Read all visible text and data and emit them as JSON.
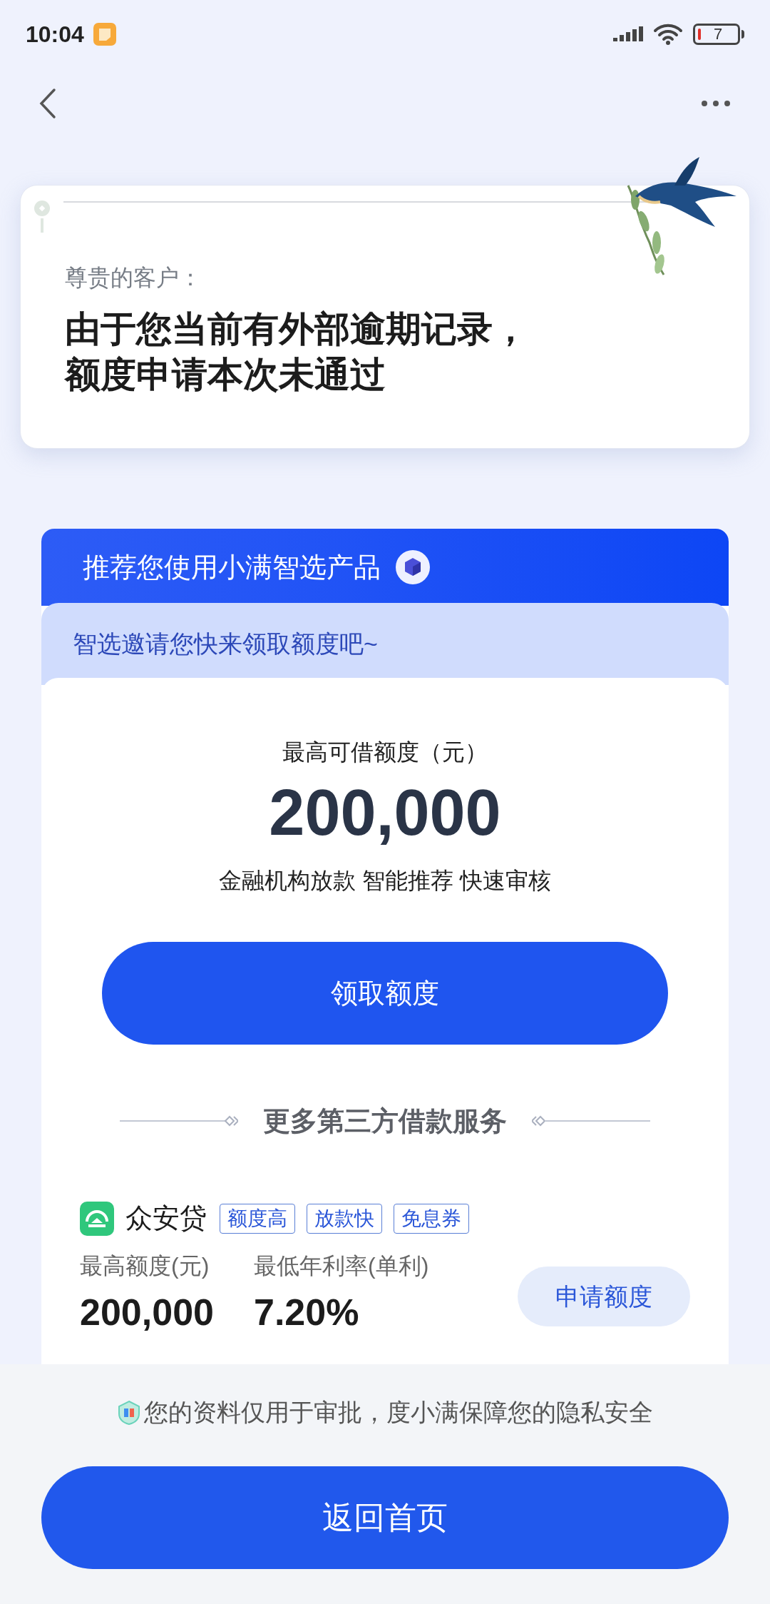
{
  "status_bar": {
    "time": "10:04",
    "battery": "7"
  },
  "notice": {
    "greeting": "尊贵的客户：",
    "message_lines": [
      "由于您当前有外部逾期记录，",
      "额度申请本次未通过"
    ]
  },
  "recommend": {
    "title": "推荐您使用小满智选产品",
    "subtitle": "智选邀请您快来领取额度吧~",
    "limit_label": "最高可借额度（元）",
    "limit_value": "200,000",
    "features": "金融机构放款 智能推荐 快速审核",
    "claim_button": "领取额度"
  },
  "more_section": {
    "title": "更多第三方借款服务"
  },
  "products": [
    {
      "name": "众安贷",
      "tags": [
        "额度高",
        "放款快",
        "免息券"
      ],
      "stats": [
        {
          "label": "最高额度(元)",
          "value": "200,000"
        },
        {
          "label": "最低年利率(单利)",
          "value": "7.20%"
        }
      ],
      "button": "申请额度"
    }
  ],
  "footer": {
    "privacy": "您的资料仅用于审批，度小满保障您的隐私安全",
    "home_button": "返回首页"
  }
}
